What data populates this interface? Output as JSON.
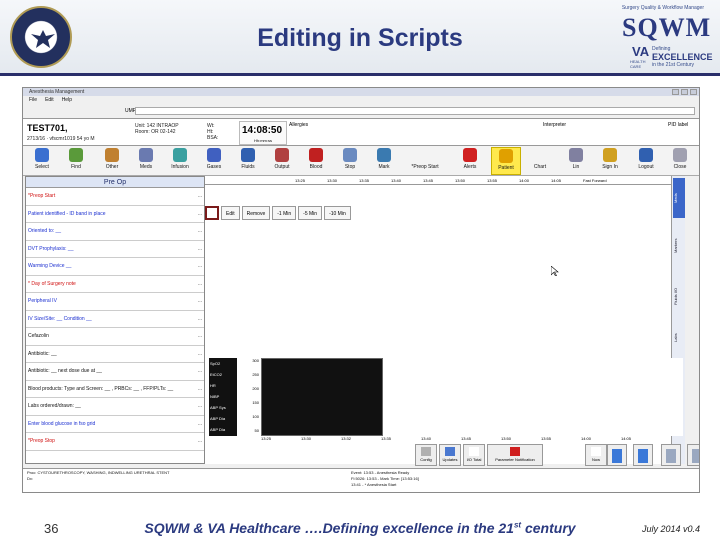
{
  "slide": {
    "title": "Editing in Scripts",
    "footer_number": "36",
    "footer_text": "SQWM & VA Healthcare ….Defining excellence in the 21",
    "footer_sup": "st",
    "footer_tail": " century",
    "footer_date": "July 2014 v0.4"
  },
  "logo": {
    "top_line1": "Surgery Quality & Workflow Manager",
    "brand": "SQWM",
    "va": "VA",
    "care": "HEALTH CARE",
    "defining": "Defining",
    "excellence": "EXCELLENCE",
    "century": "in the 21st Century"
  },
  "app": {
    "window_title": "Anesthesia Management",
    "menu": [
      "File",
      "Edit",
      "Help"
    ],
    "search_label": "UMP:",
    "patient": {
      "name": "TEST701,",
      "info": "2713/16 · vfscmr1019      54 yo  M",
      "unit": "Unit: 142 INTRAOP",
      "room": "Room: OR 02-142",
      "wt": "Wt:",
      "ht": "Ht:",
      "bsa": "BSA:",
      "time": "14:08:50",
      "time_sub": "Hh:mm:ss",
      "allergies": "Allergies",
      "interpreter": "Interpreter",
      "pid": "PID label"
    },
    "toolbar": [
      {
        "label": "Select",
        "color": "#3a6fd0"
      },
      {
        "label": "Find",
        "color": "#5a9a3a"
      },
      {
        "label": "Other",
        "color": "#c08030"
      },
      {
        "label": "Meds",
        "color": "#6a7ab0"
      },
      {
        "label": "Infusion",
        "color": "#3aa0a0"
      },
      {
        "label": "Gases",
        "color": "#4060c0"
      },
      {
        "label": "Fluids",
        "color": "#3060b0"
      },
      {
        "label": "Output",
        "color": "#b04040"
      },
      {
        "label": "Blood",
        "color": "#c02020"
      },
      {
        "label": "Stop",
        "color": "#6a8ac0"
      },
      {
        "label": "Mark",
        "color": "#3a7ab0"
      },
      {
        "label": "*Preop Start",
        "color": "#f0f0f0"
      },
      {
        "label": "Alerts",
        "color": "#d02020"
      },
      {
        "label": "Patient",
        "color": "#e0a000"
      },
      {
        "label": "Chart",
        "color": "#f0f0f0"
      },
      {
        "label": "Lin",
        "color": "#8080a0"
      },
      {
        "label": "Sign In",
        "color": "#d0a020"
      },
      {
        "label": "Logout",
        "color": "#3060b0"
      },
      {
        "label": "Close",
        "color": "#a0a0b0"
      }
    ],
    "checklist": {
      "header": "Pre Op",
      "rows": [
        {
          "text": "*Preop Start",
          "color": "red"
        },
        {
          "text": "Patient identified - ID band in place",
          "color": "blue"
        },
        {
          "text": "Oriented to:  __",
          "color": "blue"
        },
        {
          "text": "DVT Prophylaxis:  __",
          "color": "blue"
        },
        {
          "text": "Warming Device  __",
          "color": "blue"
        },
        {
          "text": "* Day of Surgery note",
          "color": "red"
        },
        {
          "text": "Peripheral IV",
          "color": "blue"
        },
        {
          "text": "IV Size/Site:  __    Condition  __",
          "color": "blue"
        },
        {
          "text": "Cefazolin",
          "color": "dark"
        },
        {
          "text": "Antibiotic:  __",
          "color": "dark"
        },
        {
          "text": "Antibiotic:  __  next dose due at  __",
          "color": "dark"
        },
        {
          "text": "Blood products: Type and Screen: __ , PRBCs: __ , FFP/PLTs:  __",
          "color": "dark"
        },
        {
          "text": "Labs ordered/drawn:  __",
          "color": "dark"
        },
        {
          "text": "Enter blood glucose in fso grid",
          "color": "blue"
        },
        {
          "text": "*Preop Stop",
          "color": "red"
        }
      ],
      "dots": "..."
    },
    "timeline": [
      "13:25",
      "13:30",
      "13:35",
      "13:40",
      "13:45",
      "13:50",
      "13:55",
      "14:00",
      "14:05",
      "Fast Forward"
    ],
    "actions": [
      "Edit",
      "Remove",
      "-1 Min",
      "-5 Min",
      "-10 Min"
    ],
    "sidetabs": [
      "Meds",
      "Markers",
      "Fluids I/O",
      "Labs"
    ],
    "vitals_labels": [
      "SpO2",
      "EtCO2",
      "HR",
      "NIBP",
      "ABP Sys",
      "ABP Dia",
      "ABP Dia"
    ],
    "vitals_axis": [
      "300",
      "250",
      "200",
      "150",
      "100",
      "50"
    ],
    "vitals_times": [
      "13:25",
      "13:30",
      "13:32",
      "13:35",
      "13:40",
      "13:45",
      "13:50",
      "13:55",
      "14:00",
      "14:05"
    ],
    "bottom_buttons": [
      "Config",
      "Updates",
      "I/O Total",
      "Parameter Notification",
      "Now"
    ],
    "status_left": [
      "Proc: CYSTOURETHROSCOPY, WASHING, INDWELLING URETHRAL STENT",
      "Dx:"
    ],
    "status_right": [
      "Event: 13:53 - Anesthesia Ready",
      "Fl:5026: 13:53 - Mark Time: [13:53:16]",
      "13:41 - * Anesthesia Start"
    ]
  }
}
